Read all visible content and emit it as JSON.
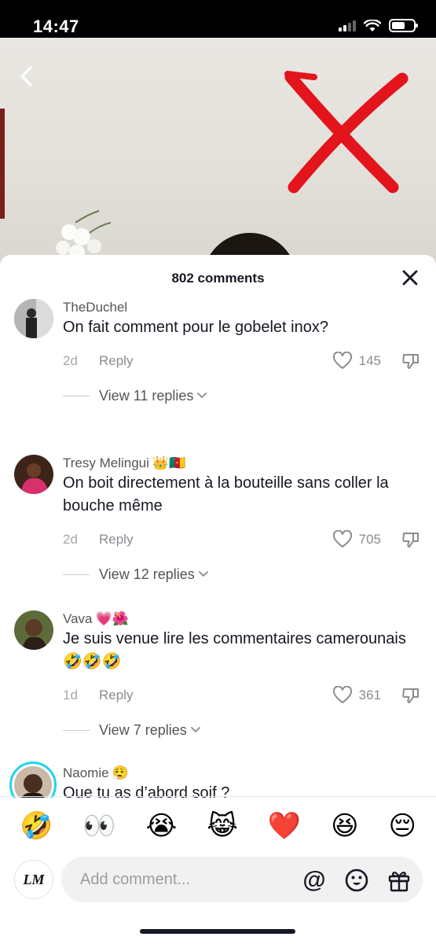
{
  "status_bar": {
    "time": "14:47"
  },
  "sheet": {
    "comment_count": "802 comments",
    "comments": [
      {
        "username": "TheDuchel",
        "user_emoji": "",
        "text": "On fait comment pour le gobelet inox?",
        "age": "2d",
        "reply_label": "Reply",
        "likes": "145",
        "view_replies": "View 11 replies",
        "avatar_color": "#9a9a9a"
      },
      {
        "username": "Tresy Melingui",
        "user_emoji": "👑🇨🇲",
        "text": "On boit directement à la bouteille sans coller la bouche même",
        "age": "2d",
        "reply_label": "Reply",
        "likes": "705",
        "view_replies": "View 12 replies",
        "avatar_color": "#c8306a"
      },
      {
        "username": "Vava",
        "user_emoji": "💗🌺",
        "text": "Je suis venue lire les commentaires camerounais 🤣🤣🤣",
        "age": "1d",
        "reply_label": "Reply",
        "likes": "361",
        "view_replies": "View 7 replies",
        "avatar_color": "#6b5a3a"
      },
      {
        "username": "Naomie",
        "user_emoji": "😮‍💨",
        "text": "Que tu as d’abord soif ?",
        "age": "",
        "reply_label": "",
        "likes": "",
        "view_replies": "",
        "avatar_color": "#3a2a22"
      }
    ]
  },
  "emoji_bar": [
    "🤣",
    "👀",
    "😭",
    "😹",
    "❤️",
    "😆",
    "😔"
  ],
  "input": {
    "placeholder": "Add comment...",
    "avatar_text": "LM"
  },
  "colors": {
    "text_primary": "#161823",
    "text_secondary": "#8a8b91",
    "red_x": "#e3141b",
    "story_ring": "#20d5ec"
  },
  "icons": [
    "back-chevron-icon",
    "close-icon",
    "heart-icon",
    "dislike-icon",
    "chevron-down-icon",
    "at-icon",
    "emoji-icon",
    "gift-icon"
  ]
}
